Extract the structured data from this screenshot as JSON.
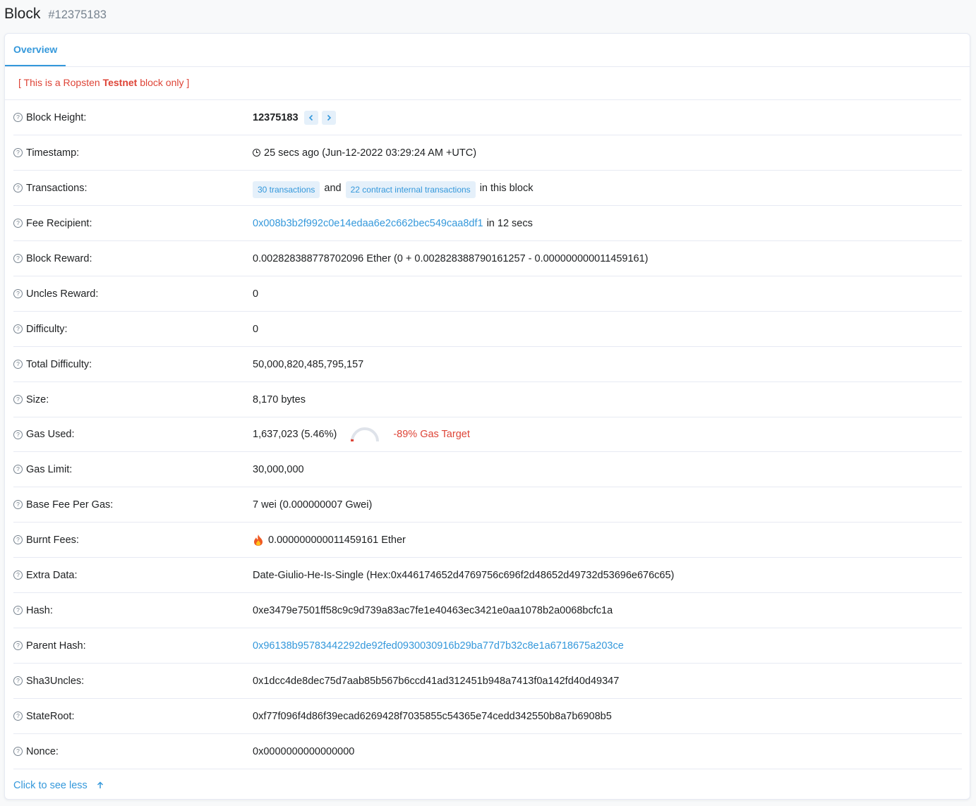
{
  "header": {
    "title": "Block",
    "block_number": "#12375183"
  },
  "tabs": [
    {
      "label": "Overview",
      "active": true
    }
  ],
  "notice": {
    "prefix": "[ This is a Ropsten ",
    "bold": "Testnet",
    "suffix": " block only ]"
  },
  "rows": {
    "block_height": {
      "label": "Block Height:",
      "value": "12375183"
    },
    "timestamp": {
      "label": "Timestamp:",
      "value": "25 secs ago (Jun-12-2022 03:29:24 AM +UTC)"
    },
    "transactions": {
      "label": "Transactions:",
      "tx_pill": "30 transactions",
      "and": "and",
      "internal_pill": "22 contract internal transactions",
      "suffix": "in this block"
    },
    "fee_recipient": {
      "label": "Fee Recipient:",
      "address": "0x008b3b2f992c0e14edaa6e2c662bec549caa8df1",
      "suffix": "in 12 secs"
    },
    "block_reward": {
      "label": "Block Reward:",
      "value": "0.002828388778702096 Ether (0 + 0.002828388790161257 - 0.000000000011459161)"
    },
    "uncles_reward": {
      "label": "Uncles Reward:",
      "value": "0"
    },
    "difficulty": {
      "label": "Difficulty:",
      "value": "0"
    },
    "total_difficulty": {
      "label": "Total Difficulty:",
      "value": "50,000,820,485,795,157"
    },
    "size": {
      "label": "Size:",
      "value": "8,170 bytes"
    },
    "gas_used": {
      "label": "Gas Used:",
      "value": "1,637,023 (5.46%)",
      "gas_target": "-89% Gas Target",
      "gauge_fraction": 0.0546
    },
    "gas_limit": {
      "label": "Gas Limit:",
      "value": "30,000,000"
    },
    "base_fee": {
      "label": "Base Fee Per Gas:",
      "value": "7 wei (0.000000007 Gwei)"
    },
    "burnt_fees": {
      "label": "Burnt Fees:",
      "value": "0.000000000011459161 Ether"
    },
    "extra_data": {
      "label": "Extra Data:",
      "value": "Date-Giulio-He-Is-Single (Hex:0x446174652d4769756c696f2d48652d49732d53696e676c65)"
    },
    "hash": {
      "label": "Hash:",
      "value": "0xe3479e7501ff58c9c9d739a83ac7fe1e40463ec3421e0aa1078b2a0068bcfc1a"
    },
    "parent_hash": {
      "label": "Parent Hash:",
      "value": "0x96138b95783442292de92fed0930030916b29ba77d7b32c8e1a6718675a203ce"
    },
    "sha3uncles": {
      "label": "Sha3Uncles:",
      "value": "0x1dcc4de8dec75d7aab85b567b6ccd41ad312451b948a7413f0a142fd40d49347"
    },
    "state_root": {
      "label": "StateRoot:",
      "value": "0xf77f096f4d86f39ecad6269428f7035855c54365e74cedd342550b8a7b6908b5"
    },
    "nonce": {
      "label": "Nonce:",
      "value": "0x0000000000000000"
    }
  },
  "footer": {
    "see_less": "Click to see less"
  },
  "colors": {
    "accent": "#3498db",
    "danger": "#de4437",
    "text": "#1e2022",
    "muted": "#77838f"
  }
}
